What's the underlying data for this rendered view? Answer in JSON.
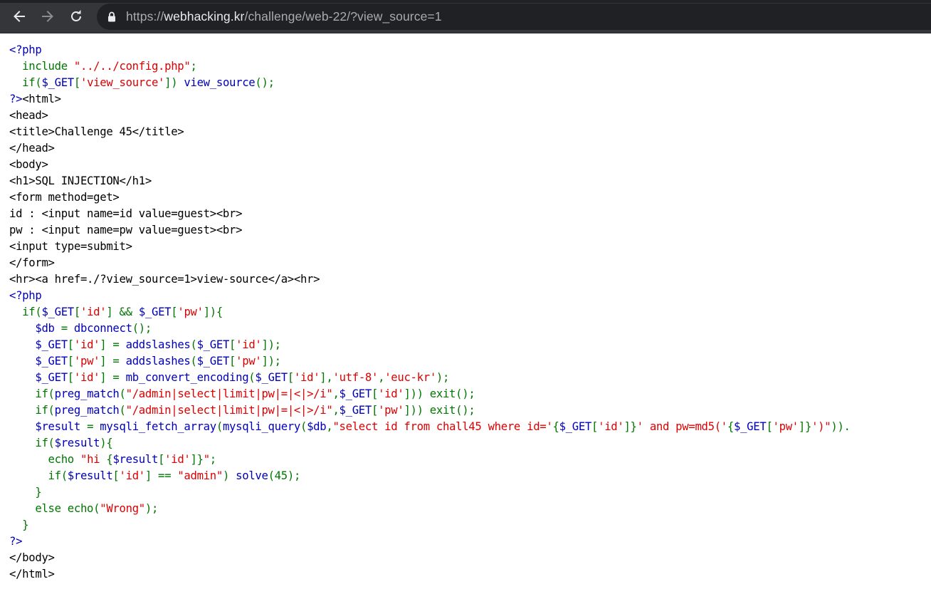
{
  "browser": {
    "url_scheme": "https://",
    "url_host": "webhacking.kr",
    "url_path": "/challenge/web-22/?view_source=1",
    "icons": {
      "back": "arrow-left-icon",
      "forward": "arrow-right-icon",
      "reload": "reload-icon",
      "lock": "lock-icon"
    }
  },
  "source_lines": [
    [
      {
        "t": "<?php",
        "c": "php"
      }
    ],
    [
      {
        "t": "  include ",
        "c": "kw"
      },
      {
        "t": "\"../../config.php\"",
        "c": "str"
      },
      {
        "t": ";",
        "c": "kw"
      }
    ],
    [
      {
        "t": "  if(",
        "c": "kw"
      },
      {
        "t": "$_GET",
        "c": "php"
      },
      {
        "t": "[",
        "c": "kw"
      },
      {
        "t": "'view_source'",
        "c": "str"
      },
      {
        "t": "]) ",
        "c": "kw"
      },
      {
        "t": "view_source",
        "c": "php"
      },
      {
        "t": "();",
        "c": "kw"
      }
    ],
    [
      {
        "t": "?>",
        "c": "php"
      },
      {
        "t": "<html>",
        "c": "html"
      }
    ],
    [
      {
        "t": "<head>",
        "c": "html"
      }
    ],
    [
      {
        "t": "<title>Challenge 45</title>",
        "c": "html"
      }
    ],
    [
      {
        "t": "</head>",
        "c": "html"
      }
    ],
    [
      {
        "t": "<body>",
        "c": "html"
      }
    ],
    [
      {
        "t": "<h1>SQL INJECTION</h1>",
        "c": "html"
      }
    ],
    [
      {
        "t": "<form method=get>",
        "c": "html"
      }
    ],
    [
      {
        "t": "id : <input name=id value=guest><br>",
        "c": "html"
      }
    ],
    [
      {
        "t": "pw : <input name=pw value=guest><br>",
        "c": "html"
      }
    ],
    [
      {
        "t": "<input type=submit>",
        "c": "html"
      }
    ],
    [
      {
        "t": "</form>",
        "c": "html"
      }
    ],
    [
      {
        "t": "<hr><a href=./?view_source=1>view-source</a><hr>",
        "c": "html"
      }
    ],
    [
      {
        "t": "<?php",
        "c": "php"
      }
    ],
    [
      {
        "t": "  if(",
        "c": "kw"
      },
      {
        "t": "$_GET",
        "c": "php"
      },
      {
        "t": "[",
        "c": "kw"
      },
      {
        "t": "'id'",
        "c": "str"
      },
      {
        "t": "] && ",
        "c": "kw"
      },
      {
        "t": "$_GET",
        "c": "php"
      },
      {
        "t": "[",
        "c": "kw"
      },
      {
        "t": "'pw'",
        "c": "str"
      },
      {
        "t": "]){",
        "c": "kw"
      }
    ],
    [
      {
        "t": "    $db ",
        "c": "php"
      },
      {
        "t": "= ",
        "c": "kw"
      },
      {
        "t": "dbconnect",
        "c": "php"
      },
      {
        "t": "();",
        "c": "kw"
      }
    ],
    [
      {
        "t": "    $_GET",
        "c": "php"
      },
      {
        "t": "[",
        "c": "kw"
      },
      {
        "t": "'id'",
        "c": "str"
      },
      {
        "t": "] = ",
        "c": "kw"
      },
      {
        "t": "addslashes",
        "c": "php"
      },
      {
        "t": "(",
        "c": "kw"
      },
      {
        "t": "$_GET",
        "c": "php"
      },
      {
        "t": "[",
        "c": "kw"
      },
      {
        "t": "'id'",
        "c": "str"
      },
      {
        "t": "]);",
        "c": "kw"
      }
    ],
    [
      {
        "t": "    $_GET",
        "c": "php"
      },
      {
        "t": "[",
        "c": "kw"
      },
      {
        "t": "'pw'",
        "c": "str"
      },
      {
        "t": "] = ",
        "c": "kw"
      },
      {
        "t": "addslashes",
        "c": "php"
      },
      {
        "t": "(",
        "c": "kw"
      },
      {
        "t": "$_GET",
        "c": "php"
      },
      {
        "t": "[",
        "c": "kw"
      },
      {
        "t": "'pw'",
        "c": "str"
      },
      {
        "t": "]);",
        "c": "kw"
      }
    ],
    [
      {
        "t": "    $_GET",
        "c": "php"
      },
      {
        "t": "[",
        "c": "kw"
      },
      {
        "t": "'id'",
        "c": "str"
      },
      {
        "t": "] = ",
        "c": "kw"
      },
      {
        "t": "mb_convert_encoding",
        "c": "php"
      },
      {
        "t": "(",
        "c": "kw"
      },
      {
        "t": "$_GET",
        "c": "php"
      },
      {
        "t": "[",
        "c": "kw"
      },
      {
        "t": "'id'",
        "c": "str"
      },
      {
        "t": "],",
        "c": "kw"
      },
      {
        "t": "'utf-8'",
        "c": "str"
      },
      {
        "t": ",",
        "c": "kw"
      },
      {
        "t": "'euc-kr'",
        "c": "str"
      },
      {
        "t": ");",
        "c": "kw"
      }
    ],
    [
      {
        "t": "    if(",
        "c": "kw"
      },
      {
        "t": "preg_match",
        "c": "php"
      },
      {
        "t": "(",
        "c": "kw"
      },
      {
        "t": "\"/admin|select|limit|pw|=|<|>/i\"",
        "c": "str"
      },
      {
        "t": ",",
        "c": "kw"
      },
      {
        "t": "$_GET",
        "c": "php"
      },
      {
        "t": "[",
        "c": "kw"
      },
      {
        "t": "'id'",
        "c": "str"
      },
      {
        "t": "])) exit();",
        "c": "kw"
      }
    ],
    [
      {
        "t": "    if(",
        "c": "kw"
      },
      {
        "t": "preg_match",
        "c": "php"
      },
      {
        "t": "(",
        "c": "kw"
      },
      {
        "t": "\"/admin|select|limit|pw|=|<|>/i\"",
        "c": "str"
      },
      {
        "t": ",",
        "c": "kw"
      },
      {
        "t": "$_GET",
        "c": "php"
      },
      {
        "t": "[",
        "c": "kw"
      },
      {
        "t": "'pw'",
        "c": "str"
      },
      {
        "t": "])) exit();",
        "c": "kw"
      }
    ],
    [
      {
        "t": "    $result ",
        "c": "php"
      },
      {
        "t": "= ",
        "c": "kw"
      },
      {
        "t": "mysqli_fetch_array",
        "c": "php"
      },
      {
        "t": "(",
        "c": "kw"
      },
      {
        "t": "mysqli_query",
        "c": "php"
      },
      {
        "t": "(",
        "c": "kw"
      },
      {
        "t": "$db",
        "c": "php"
      },
      {
        "t": ",",
        "c": "kw"
      },
      {
        "t": "\"select id from chall45 where id='",
        "c": "str"
      },
      {
        "t": "{",
        "c": "kw"
      },
      {
        "t": "$_GET",
        "c": "php"
      },
      {
        "t": "[",
        "c": "kw"
      },
      {
        "t": "'id'",
        "c": "str"
      },
      {
        "t": "]}",
        "c": "kw"
      },
      {
        "t": "' and pw=md5('",
        "c": "str"
      },
      {
        "t": "{",
        "c": "kw"
      },
      {
        "t": "$_GET",
        "c": "php"
      },
      {
        "t": "[",
        "c": "kw"
      },
      {
        "t": "'pw'",
        "c": "str"
      },
      {
        "t": "]}",
        "c": "kw"
      },
      {
        "t": "')\"",
        "c": "str"
      },
      {
        "t": ")).",
        "c": "kw"
      }
    ],
    [
      {
        "t": "    if(",
        "c": "kw"
      },
      {
        "t": "$result",
        "c": "php"
      },
      {
        "t": "){",
        "c": "kw"
      }
    ],
    [
      {
        "t": "      echo ",
        "c": "kw"
      },
      {
        "t": "\"hi ",
        "c": "str"
      },
      {
        "t": "{",
        "c": "kw"
      },
      {
        "t": "$result",
        "c": "php"
      },
      {
        "t": "[",
        "c": "kw"
      },
      {
        "t": "'id'",
        "c": "str"
      },
      {
        "t": "]}",
        "c": "kw"
      },
      {
        "t": "\"",
        "c": "str"
      },
      {
        "t": ";",
        "c": "kw"
      }
    ],
    [
      {
        "t": "      if(",
        "c": "kw"
      },
      {
        "t": "$result",
        "c": "php"
      },
      {
        "t": "[",
        "c": "kw"
      },
      {
        "t": "'id'",
        "c": "str"
      },
      {
        "t": "] == ",
        "c": "kw"
      },
      {
        "t": "\"admin\"",
        "c": "str"
      },
      {
        "t": ") ",
        "c": "kw"
      },
      {
        "t": "solve",
        "c": "php"
      },
      {
        "t": "(45);",
        "c": "kw"
      }
    ],
    [
      {
        "t": "    }",
        "c": "kw"
      }
    ],
    [
      {
        "t": "    else echo(",
        "c": "kw"
      },
      {
        "t": "\"Wrong\"",
        "c": "str"
      },
      {
        "t": ");",
        "c": "kw"
      }
    ],
    [
      {
        "t": "  }",
        "c": "kw"
      }
    ],
    [
      {
        "t": "?>",
        "c": "php"
      }
    ],
    [
      {
        "t": "</body>",
        "c": "html"
      }
    ],
    [
      {
        "t": "</html>",
        "c": "html"
      }
    ]
  ]
}
